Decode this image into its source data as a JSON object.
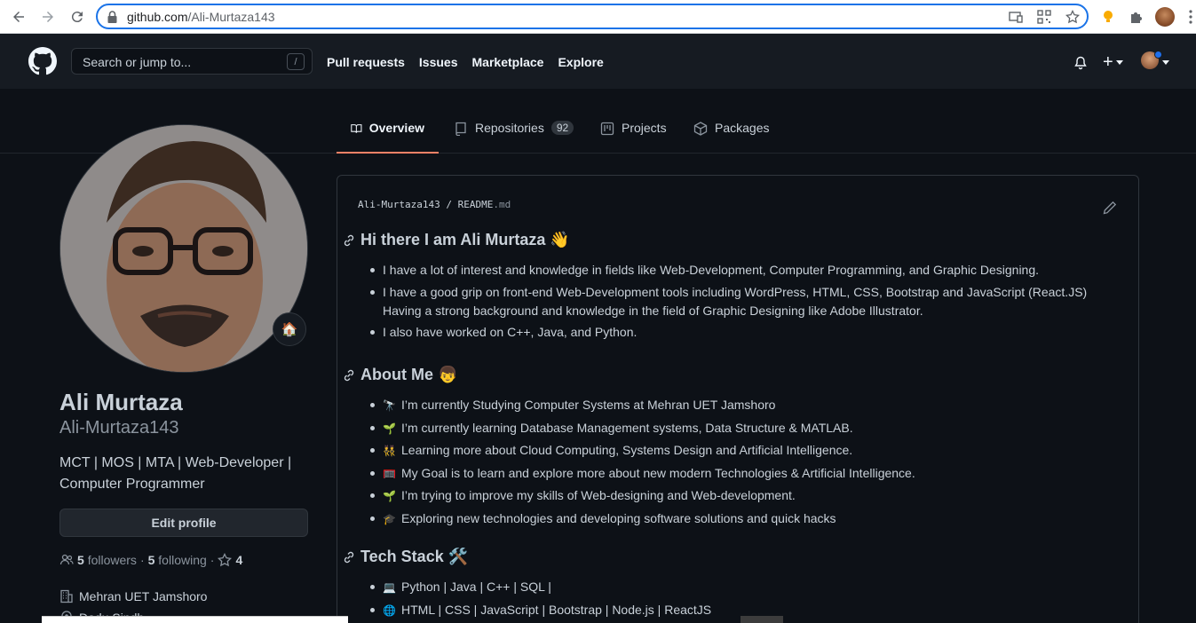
{
  "browser": {
    "url_host": "github.com",
    "url_path": "/Ali-Murtaza143",
    "icons": [
      "back-icon",
      "forward-icon",
      "reload-icon",
      "lock-icon",
      "cast-icon",
      "qr-icon",
      "star-icon",
      "bulb-icon",
      "puzzle-icon",
      "kebab-icon"
    ]
  },
  "header": {
    "search_placeholder": "Search or jump to...",
    "search_shortcut": "/",
    "nav": [
      "Pull requests",
      "Issues",
      "Marketplace",
      "Explore"
    ],
    "plus_label": "+"
  },
  "tabs": [
    {
      "label": "Overview",
      "active": true
    },
    {
      "label": "Repositories",
      "count": "92"
    },
    {
      "label": "Projects"
    },
    {
      "label": "Packages"
    }
  ],
  "profile": {
    "status_emoji": "🏠",
    "name": "Ali Murtaza",
    "login": "Ali-Murtaza143",
    "bio": "MCT | MOS | MTA | Web-Developer | Computer Programmer",
    "edit_label": "Edit profile",
    "followers_count": "5",
    "followers_label": "followers",
    "following_count": "5",
    "following_label": "following",
    "separator": "·",
    "stars_count": "4",
    "org": "Mehran UET Jamshoro",
    "location": "Dadu,Sindh"
  },
  "readme": {
    "owner": "Ali-Murtaza143",
    "slash": "/",
    "file": "README",
    "ext": ".md",
    "sections": [
      {
        "title": "Hi there I am Ali Murtaza",
        "emoji": "👋",
        "items": [
          {
            "emoji": "",
            "text": "I have a lot of interest and knowledge in fields like Web-Development, Computer Programming, and Graphic Designing."
          },
          {
            "emoji": "",
            "text": "I have a good grip on front-end Web-Development tools including WordPress, HTML, CSS, Bootstrap and JavaScript (React.JS) Having a strong background and knowledge in the field of Graphic Designing like Adobe Illustrator."
          },
          {
            "emoji": "",
            "text": "I also have worked on C++, Java, and Python."
          }
        ]
      },
      {
        "title": "About Me",
        "emoji": "👦",
        "items": [
          {
            "emoji": "🔭",
            "text": "I’m currently Studying Computer Systems at Mehran UET Jamshoro"
          },
          {
            "emoji": "🌱",
            "text": "I’m currently learning Database Management systems, Data Structure & MATLAB."
          },
          {
            "emoji": "👯",
            "text": "Learning more about Cloud Computing, Systems Design and Artificial Intelligence."
          },
          {
            "emoji": "🥅",
            "text": "My Goal is to learn and explore more about new modern Technologies & Artificial Intelligence."
          },
          {
            "emoji": "🌱",
            "text": "I’m trying to improve my skills of Web-designing and Web-development."
          },
          {
            "emoji": "🎓",
            "text": "Exploring new technologies and developing software solutions and quick hacks"
          }
        ]
      },
      {
        "title": "Tech Stack",
        "emoji": "🛠️",
        "items": [
          {
            "emoji": "💻",
            "text": "Python | Java | C++ | SQL |"
          },
          {
            "emoji": "🌐",
            "text": "HTML | CSS | JavaScript | Bootstrap | Node.js | ReactJS"
          }
        ]
      }
    ]
  },
  "colors": {
    "bg": "#0d1117",
    "header_bg": "#161b22",
    "border": "#30363d",
    "text": "#c9d1d9",
    "muted": "#8b949e",
    "tab_accent": "#f78166",
    "omnibox_focus": "#1a73e8"
  }
}
